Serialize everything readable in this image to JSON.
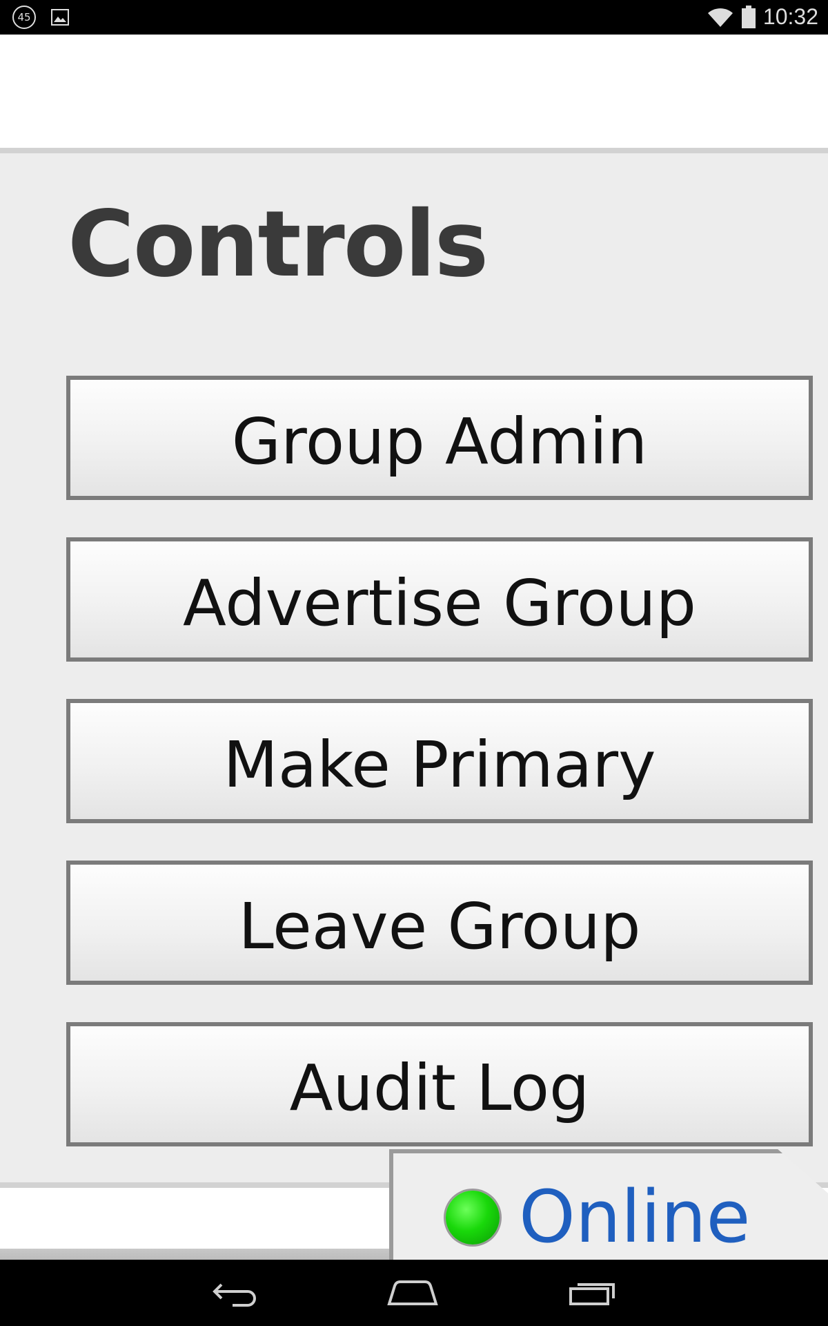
{
  "status_bar": {
    "badge": "45",
    "time": "10:32",
    "icons": [
      "notification-badge-icon",
      "image-icon",
      "wifi-icon",
      "battery-icon"
    ]
  },
  "controls": {
    "title": "Controls",
    "buttons": [
      {
        "label": "Group Admin"
      },
      {
        "label": "Advertise Group"
      },
      {
        "label": "Make Primary"
      },
      {
        "label": "Leave Group"
      },
      {
        "label": "Audit Log"
      }
    ]
  },
  "connection": {
    "status": "Online",
    "indicator_color": "#19d80a",
    "text_color": "#1f5fbf"
  },
  "nav_bar": {
    "icons": [
      "back-icon",
      "home-icon",
      "recent-apps-icon"
    ]
  }
}
